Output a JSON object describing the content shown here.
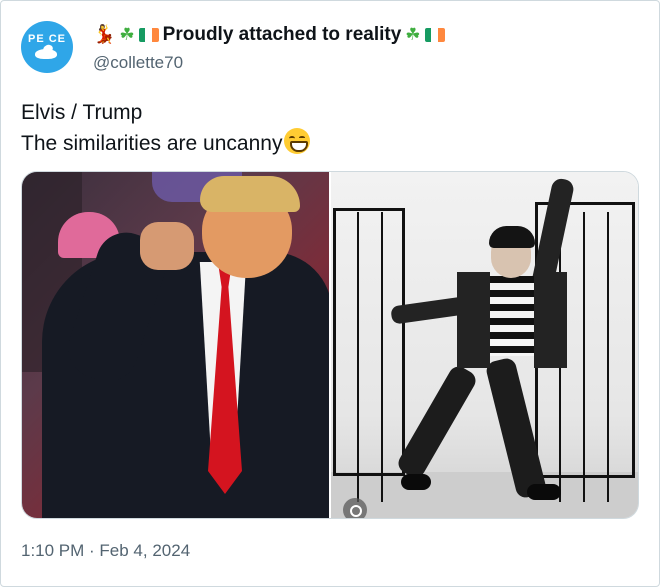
{
  "user": {
    "avatar_text": "PE CE",
    "display_name": "Proudly attached to reality",
    "handle": "@collette70",
    "name_prefix_icons": [
      "dancer-icon",
      "shamrock-icon",
      "irish-flag-icon"
    ],
    "name_suffix_icons": [
      "shamrock-icon",
      "irish-flag-icon"
    ]
  },
  "tweet": {
    "line1": "Elvis / Trump",
    "line2": "The similarities are uncanny",
    "emoji": "grinning-face-icon"
  },
  "media": {
    "images": [
      "trump-dancing-photo",
      "elvis-dancing-photo"
    ]
  },
  "meta": {
    "timestamp": "1:10 PM · Feb 4, 2024"
  },
  "colors": {
    "text_primary": "#0f1419",
    "text_secondary": "#536471",
    "avatar_bg": "#2fa6e8",
    "border": "#cfd9de"
  }
}
